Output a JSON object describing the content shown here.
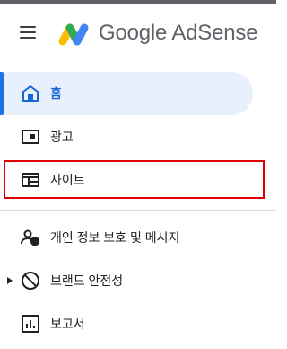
{
  "header": {
    "brand": "Google AdSense",
    "menu_icon": "hamburger-menu-icon",
    "logo_icon": "adsense-logo-icon"
  },
  "nav": {
    "items": [
      {
        "label": "홈",
        "icon": "home-icon",
        "active": true
      },
      {
        "label": "광고",
        "icon": "ads-icon",
        "active": false
      },
      {
        "label": "사이트",
        "icon": "sites-icon",
        "active": false
      },
      {
        "label": "개인 정보 보호 및 메시지",
        "icon": "privacy-messaging-icon",
        "active": false
      },
      {
        "label": "브랜드 안전성",
        "icon": "brand-safety-icon",
        "active": false,
        "expandable": true
      },
      {
        "label": "보고서",
        "icon": "reports-icon",
        "active": false
      }
    ]
  },
  "annotation": {
    "highlighted_item": "사이트",
    "color": "#e00000"
  },
  "colors": {
    "accent": "#1a73e8",
    "active_bg": "#e8f0fe",
    "active_text": "#1967d2",
    "text": "#202124",
    "brand_text": "#5f6368"
  }
}
